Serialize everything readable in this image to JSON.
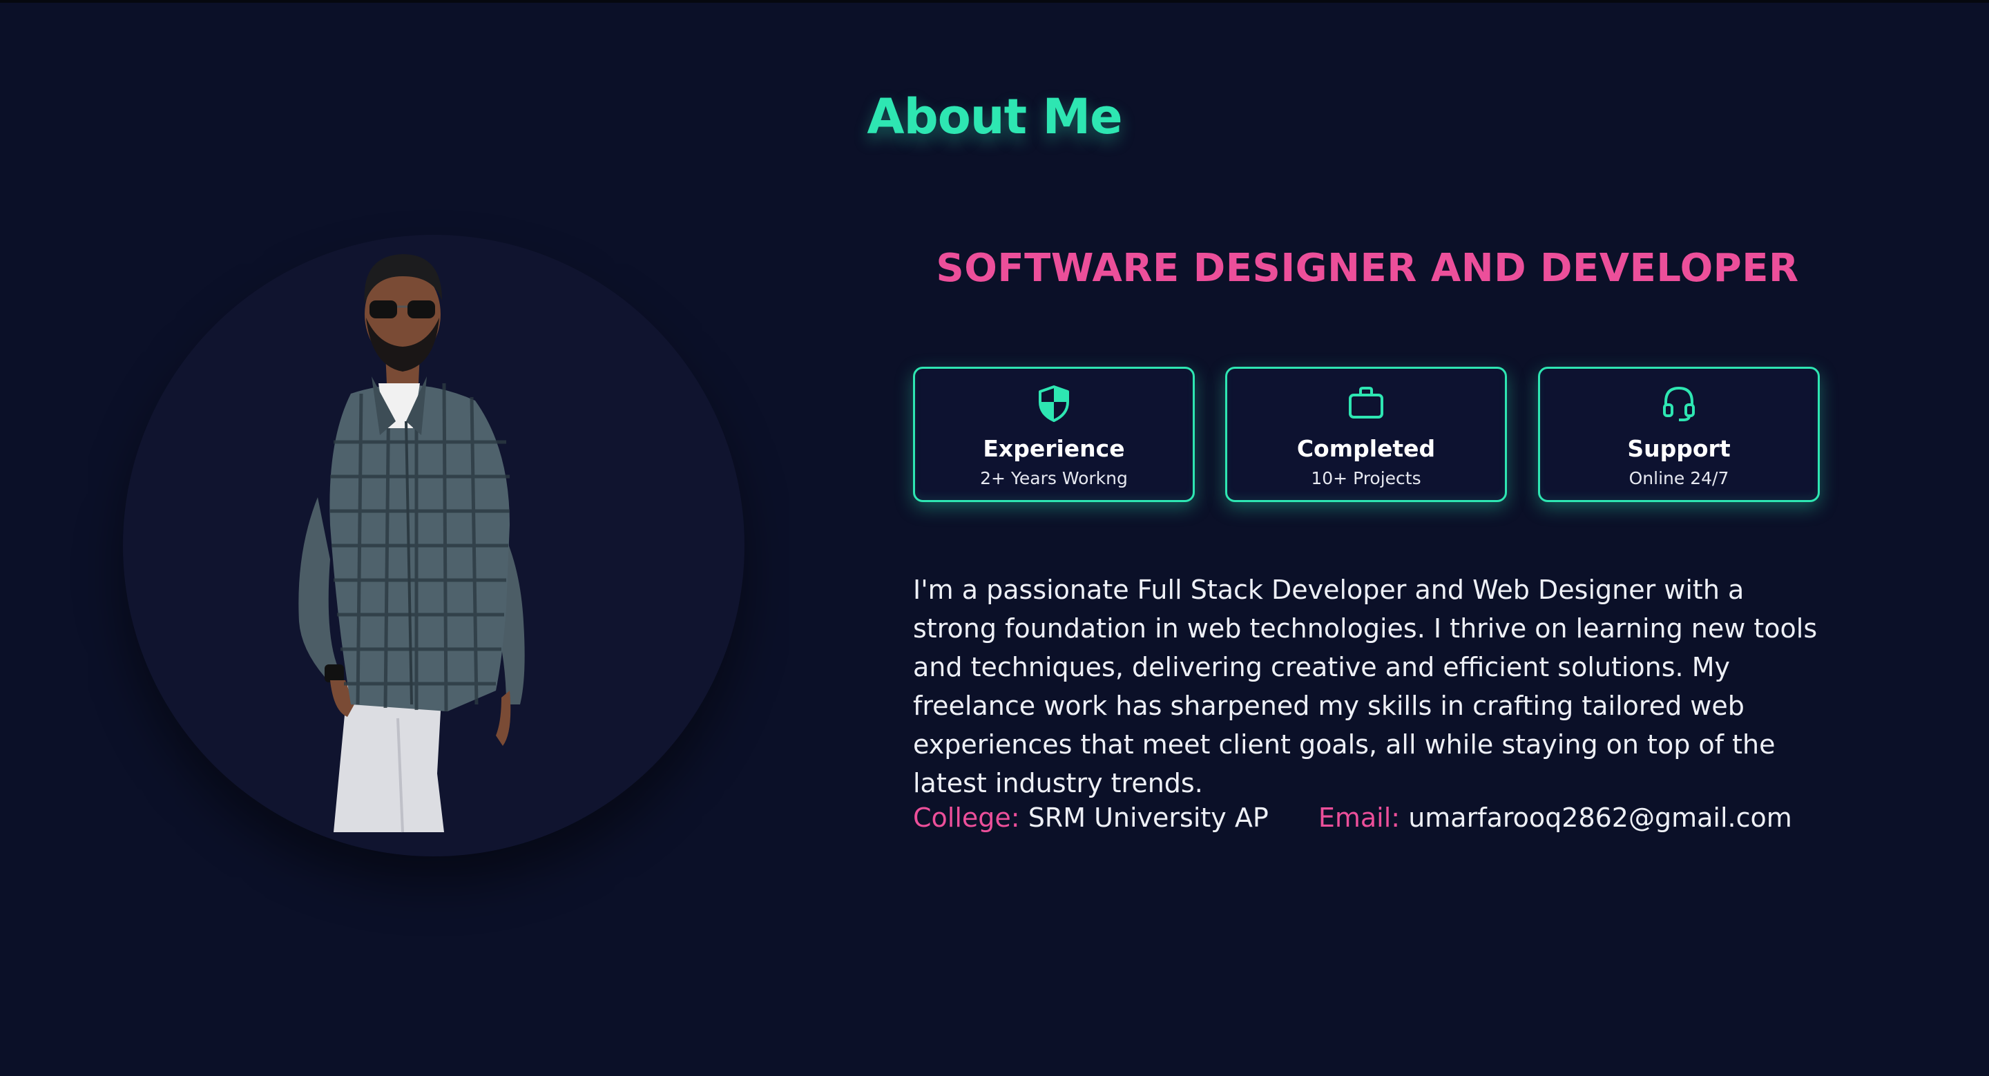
{
  "section": {
    "title": "About Me",
    "subtitle": "SOFTWARE DESIGNER AND DEVELOPER"
  },
  "photo": {
    "icon": "profile-photo"
  },
  "cards": [
    {
      "icon": "shield-icon",
      "title": "Experience",
      "subtitle": "2+ Years Workng"
    },
    {
      "icon": "briefcase-icon",
      "title": "Completed",
      "subtitle": "10+ Projects"
    },
    {
      "icon": "headset-icon",
      "title": "Support",
      "subtitle": "Online 24/7"
    }
  ],
  "bio": "I'm a passionate Full Stack Developer and Web Designer with a strong foundation in web technologies. I thrive on learning new tools and techniques, delivering creative and efficient solutions. My freelance work has sharpened my skills in crafting tailored web experiences that meet client goals, all while staying on top of the latest industry trends.",
  "info": {
    "college_label": "College:",
    "college_value": "SRM University AP",
    "email_label": "Email:",
    "email_value": "umarfarooq2862@gmail.com"
  },
  "colors": {
    "background": "#0b1028",
    "accent": "#2ee6b2",
    "pink": "#ec4f9a"
  }
}
